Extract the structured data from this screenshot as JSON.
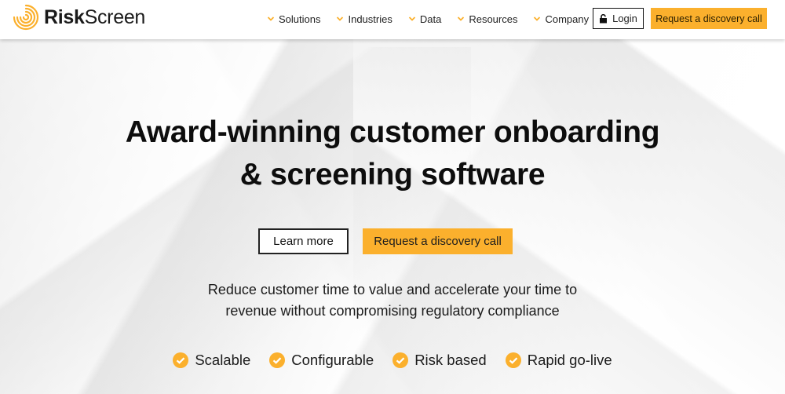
{
  "brand": {
    "name_bold": "Risk",
    "name_regular": "Screen",
    "accent_color": "#fbb02d"
  },
  "nav": {
    "items": [
      {
        "label": "Solutions",
        "icon": "chevron-down-icon"
      },
      {
        "label": "Industries",
        "icon": "chevron-down-icon"
      },
      {
        "label": "Data",
        "icon": "chevron-down-icon"
      },
      {
        "label": "Resources",
        "icon": "chevron-down-icon"
      },
      {
        "label": "Company",
        "icon": "chevron-down-icon"
      }
    ],
    "login_label": "Login",
    "login_icon": "unlock-icon",
    "cta_label": "Request a discovery call"
  },
  "hero": {
    "title_line1": "Award-winning customer onboarding",
    "title_line2": "& screening software",
    "learn_more_label": "Learn more",
    "discovery_label": "Request a discovery call",
    "subtext_line1": "Reduce customer time to value and accelerate your time to",
    "subtext_line2": "revenue without compromising regulatory compliance",
    "features": [
      {
        "label": "Scalable",
        "icon": "check-circle-icon"
      },
      {
        "label": "Configurable",
        "icon": "check-circle-icon"
      },
      {
        "label": "Risk based",
        "icon": "check-circle-icon"
      },
      {
        "label": "Rapid go-live",
        "icon": "check-circle-icon"
      }
    ]
  }
}
